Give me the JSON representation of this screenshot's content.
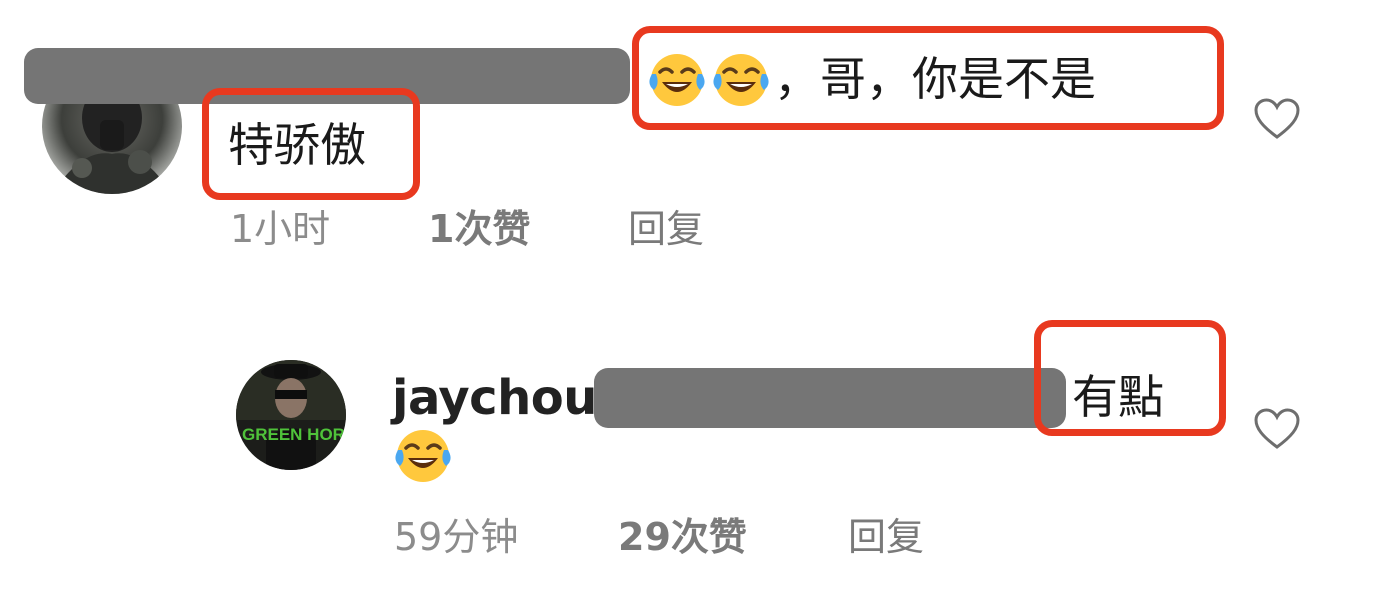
{
  "comment1": {
    "text_line1": "，哥，你是不是",
    "text_line2": "特骄傲",
    "time": "1小时",
    "likes": "1次赞",
    "reply": "回复",
    "emoji_icons": [
      "face-with-tears-of-joy-icon",
      "face-with-tears-of-joy-icon"
    ]
  },
  "reply1": {
    "username": "jaychou",
    "text_line1": "有點",
    "time": "59分钟",
    "likes": "29次赞",
    "reply": "回复",
    "emoji_icons": [
      "face-with-tears-of-joy-icon"
    ],
    "avatar_text": "GREEN HORNET"
  },
  "colors": {
    "annotation_red": "#e8391f",
    "redaction_gray": "#757575",
    "meta_gray": "#8c8c8c"
  }
}
